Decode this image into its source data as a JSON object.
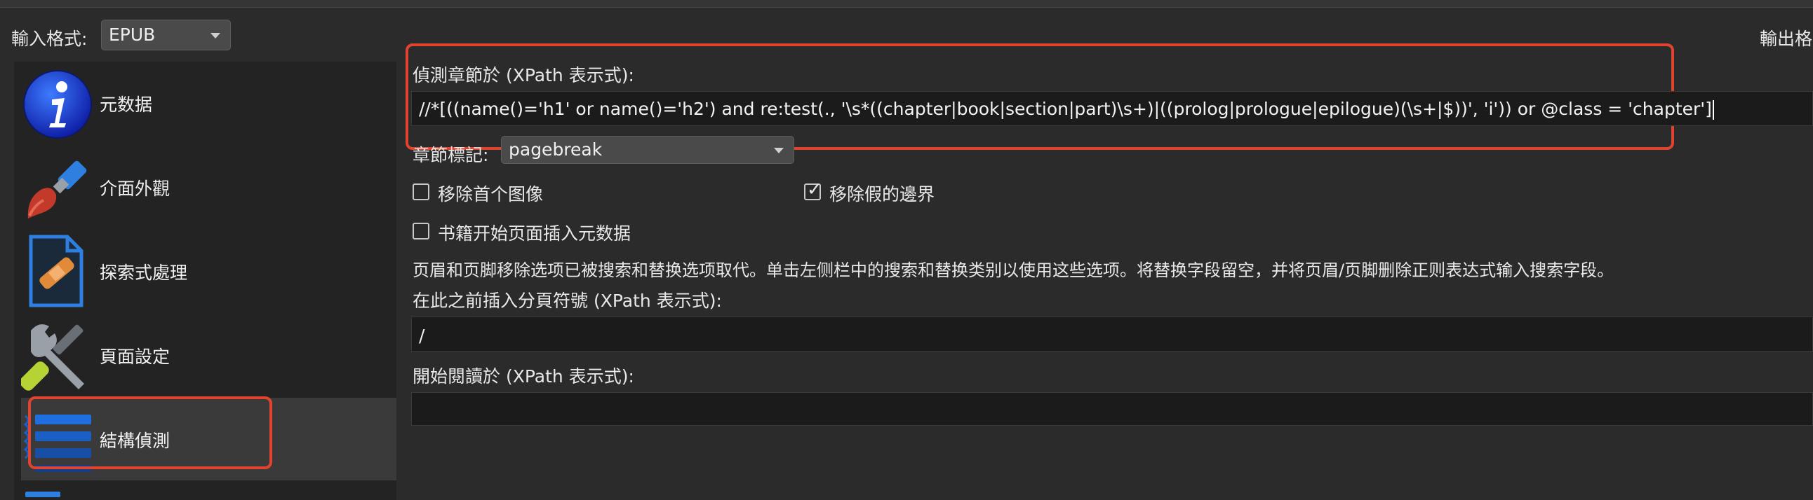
{
  "header": {
    "input_format_label": "輸入格式:",
    "input_format_value": "EPUB",
    "output_format_label": "輸出格"
  },
  "sidebar": {
    "items": [
      {
        "label": "元数据",
        "icon": "info-icon"
      },
      {
        "label": "介面外觀",
        "icon": "paintbrush-icon"
      },
      {
        "label": "探索式處理",
        "icon": "document-bandage-icon"
      },
      {
        "label": "頁面設定",
        "icon": "tools-icon"
      },
      {
        "label": "結構偵測",
        "icon": "list-icon",
        "selected": true
      }
    ]
  },
  "structure": {
    "detect_chapters_label": "偵測章節於 (XPath 表示式):",
    "detect_chapters_value": "//*[((name()='h1' or name()='h2') and re:test(., '\\s*((chapter|book|section|part)\\s+)|((prolog|prologue|epilogue)(\\s+|$))', 'i')) or @class = 'chapter']",
    "chapter_mark_label": "章節標記:",
    "chapter_mark_value": "pagebreak",
    "remove_first_image_label": "移除首个图像",
    "remove_first_image_checked": false,
    "remove_fake_margins_label": "移除假的邊界",
    "remove_fake_margins_checked": true,
    "insert_metadata_label": "书籍开始页面插入元数据",
    "insert_metadata_checked": false,
    "header_footer_note": "页眉和页脚移除选项已被搜索和替换选项取代。单击左侧栏中的搜索和替换类别以使用这些选项。将替换字段留空，并将页眉/页脚删除正则表达式输入搜索字段。",
    "page_break_label": "在此之前插入分頁符號 (XPath 表示式):",
    "page_break_value": "/",
    "start_reading_label": "開始閱讀於 (XPath 表示式):",
    "start_reading_value": ""
  },
  "colors": {
    "highlight": "#e0432f",
    "background": "#2b2b2b",
    "field_bg": "#1b1b1b"
  }
}
